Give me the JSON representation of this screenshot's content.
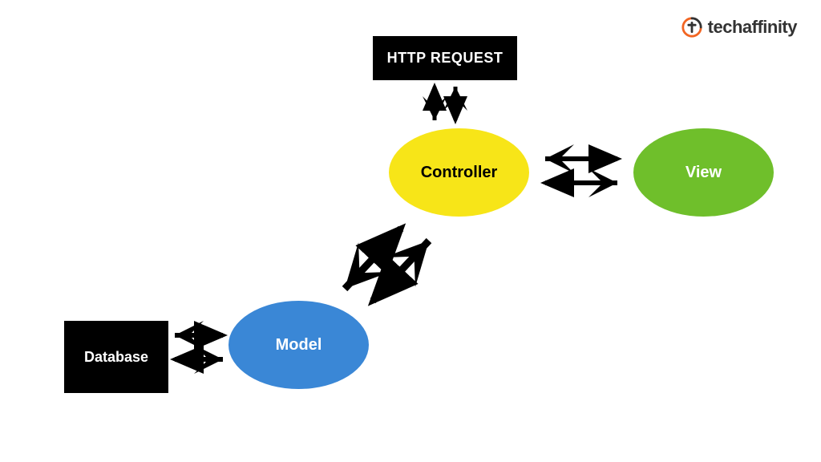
{
  "logo": {
    "text": "techaffinity"
  },
  "nodes": {
    "http": {
      "label": "HTTP REQUEST",
      "shape": "rect",
      "fill": "#000000",
      "textColor": "#ffffff"
    },
    "controller": {
      "label": "Controller",
      "shape": "ellipse",
      "fill": "#f7e518",
      "textColor": "#000000"
    },
    "view": {
      "label": "View",
      "shape": "ellipse",
      "fill": "#6fbf2b",
      "textColor": "#ffffff"
    },
    "model": {
      "label": "Model",
      "shape": "ellipse",
      "fill": "#3a87d6",
      "textColor": "#ffffff"
    },
    "database": {
      "label": "Database",
      "shape": "rect",
      "fill": "#000000",
      "textColor": "#ffffff"
    }
  },
  "edges": [
    {
      "from": "http",
      "to": "controller",
      "bidirectional": true
    },
    {
      "from": "controller",
      "to": "view",
      "bidirectional": true
    },
    {
      "from": "controller",
      "to": "model",
      "bidirectional": true
    },
    {
      "from": "model",
      "to": "database",
      "bidirectional": true
    }
  ]
}
